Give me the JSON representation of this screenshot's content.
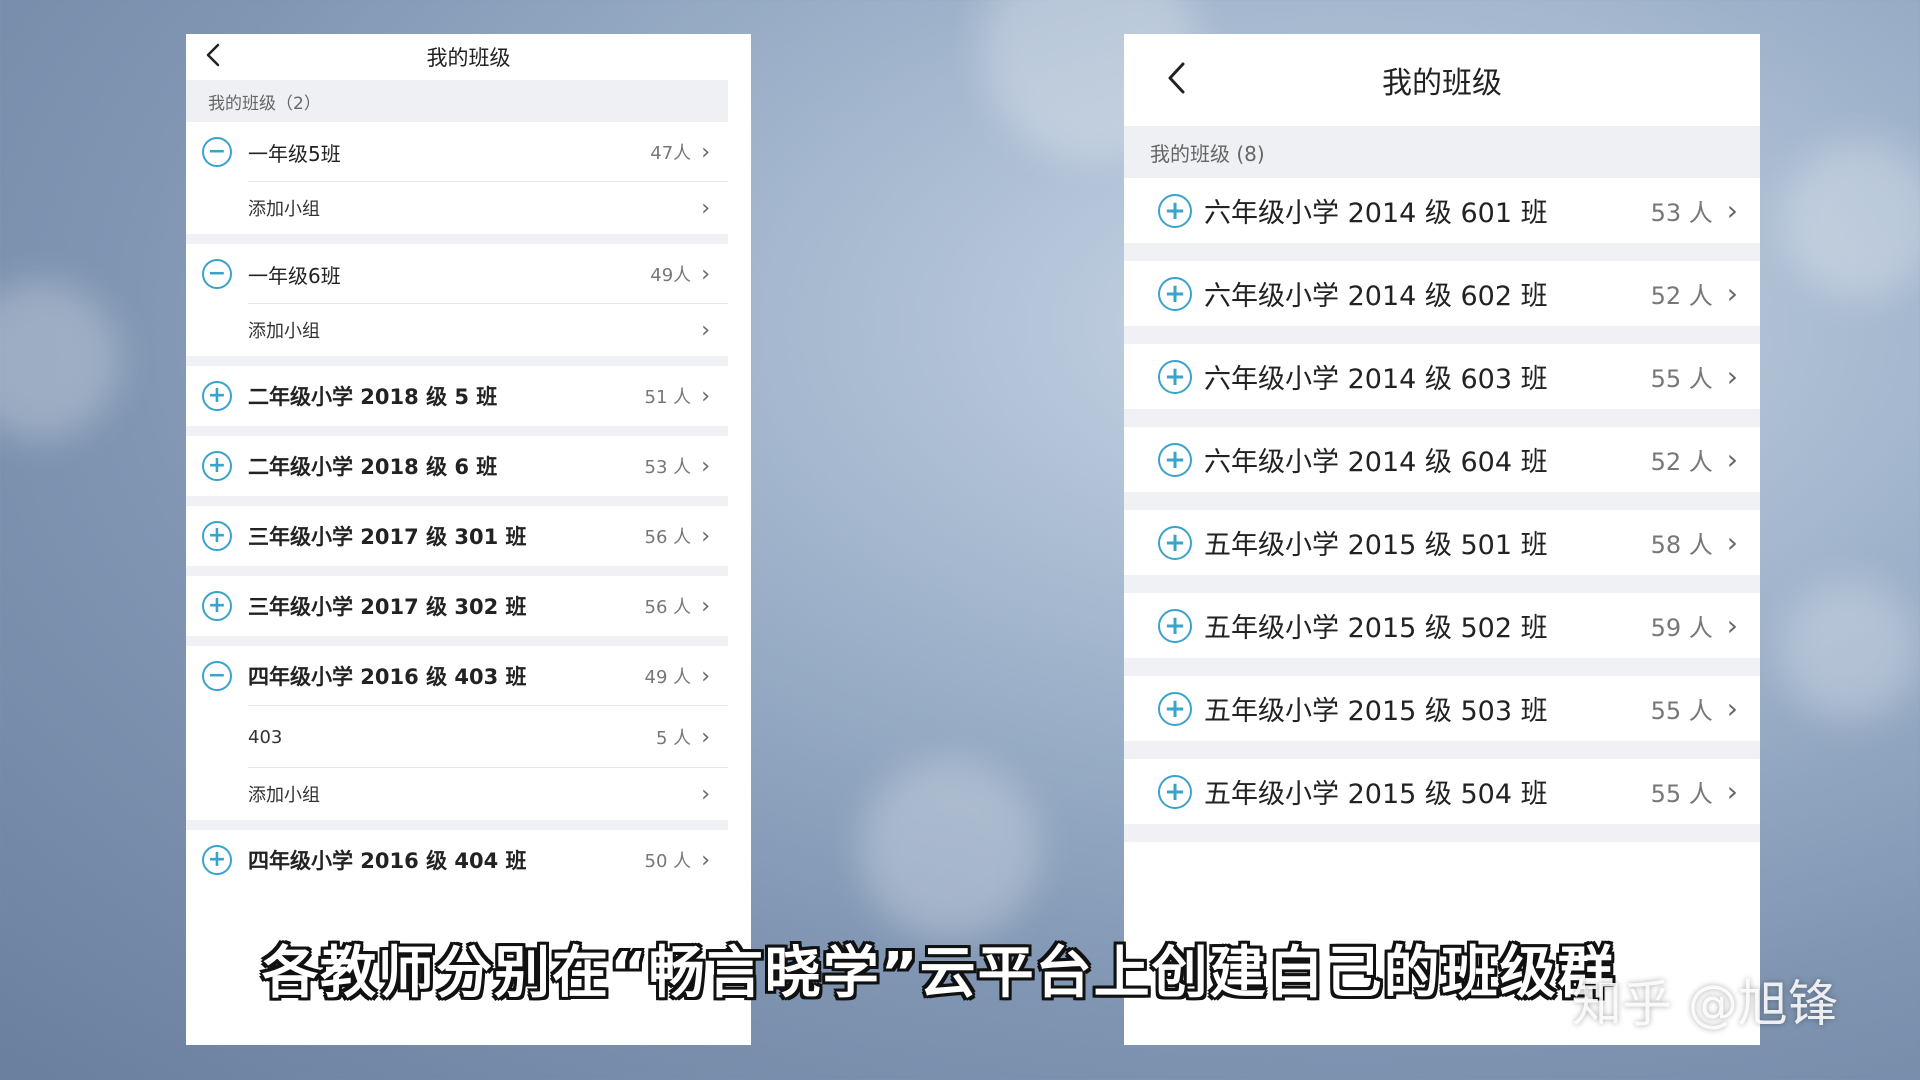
{
  "left_panel": {
    "title": "我的班级",
    "section_header": "我的班级（2）",
    "rows": [
      {
        "icon": "minus-circle-icon",
        "name": "一年级5班",
        "count": "47人",
        "type": "class",
        "divider": true
      },
      {
        "icon": "",
        "name": "添加小组",
        "count": "",
        "type": "sub",
        "group_end": true
      },
      {
        "icon": "minus-circle-icon",
        "name": "一年级6班",
        "count": "49人",
        "type": "class",
        "divider": true
      },
      {
        "icon": "",
        "name": "添加小组",
        "count": "",
        "type": "sub",
        "group_end": true
      },
      {
        "icon": "plus-circle-icon",
        "name": "二年级小学 2018 级 5 班",
        "count": "51 人",
        "type": "bold",
        "group_end": true
      },
      {
        "icon": "plus-circle-icon",
        "name": "二年级小学 2018 级 6 班",
        "count": "53 人",
        "type": "bold",
        "group_end": true
      },
      {
        "icon": "plus-circle-icon",
        "name": "三年级小学 2017 级 301 班",
        "count": "56 人",
        "type": "bold",
        "group_end": true
      },
      {
        "icon": "plus-circle-icon",
        "name": "三年级小学 2017 级 302 班",
        "count": "56 人",
        "type": "bold",
        "group_end": true
      },
      {
        "icon": "minus-circle-icon",
        "name": "四年级小学 2016 级 403 班",
        "count": "49 人",
        "type": "bold",
        "divider": true
      },
      {
        "icon": "",
        "name": "403",
        "count": "5 人",
        "type": "sub",
        "divider": true
      },
      {
        "icon": "",
        "name": "添加小组",
        "count": "",
        "type": "sub",
        "group_end": true
      },
      {
        "icon": "plus-circle-icon",
        "name": "四年级小学 2016 级 404 班",
        "count": "50 人",
        "type": "bold"
      }
    ]
  },
  "right_panel": {
    "title": "我的班级",
    "section_header": "我的班级 (8)",
    "rows": [
      {
        "icon": "plus-circle-icon",
        "name": "六年级小学 2014 级 601 班",
        "count": "53 人"
      },
      {
        "icon": "plus-circle-icon",
        "name": "六年级小学 2014 级 602 班",
        "count": "52 人"
      },
      {
        "icon": "plus-circle-icon",
        "name": "六年级小学 2014 级 603 班",
        "count": "55 人"
      },
      {
        "icon": "plus-circle-icon",
        "name": "六年级小学 2014 级 604 班",
        "count": "52 人"
      },
      {
        "icon": "plus-circle-icon",
        "name": "五年级小学 2015 级 501 班",
        "count": "58 人"
      },
      {
        "icon": "plus-circle-icon",
        "name": "五年级小学 2015 级 502 班",
        "count": "59 人"
      },
      {
        "icon": "plus-circle-icon",
        "name": "五年级小学 2015 级 503 班",
        "count": "55 人"
      },
      {
        "icon": "plus-circle-icon",
        "name": "五年级小学 2015 级 504 班",
        "count": "55 人"
      }
    ]
  },
  "caption": "各教师分别在“畅言晓学”云平台上创建自己的班级群",
  "watermark": "知乎 @旭锋",
  "colors": {
    "accent": "#3aa3c8",
    "section_bg": "#eef0f4"
  }
}
